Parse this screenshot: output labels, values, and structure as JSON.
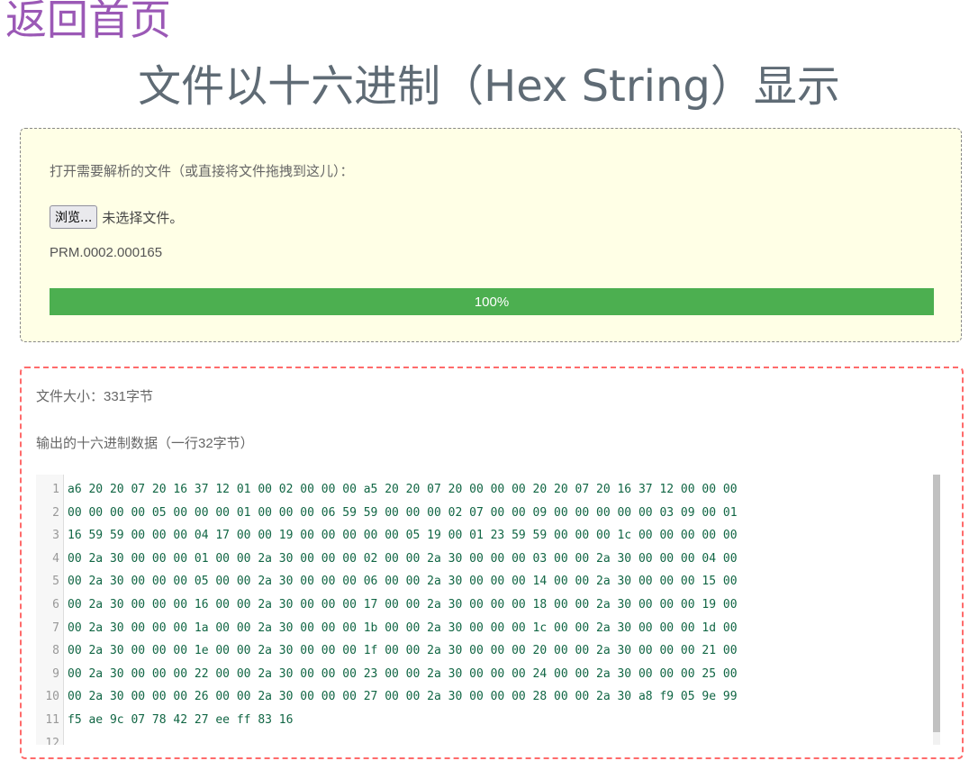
{
  "nav": {
    "back_label": "返回首页"
  },
  "header": {
    "title": "文件以十六进制（Hex String）显示"
  },
  "upload": {
    "prompt": "打开需要解析的文件（或直接将文件拖拽到这儿）：",
    "browse_label": "浏览...",
    "no_file_label": "未选择文件。",
    "file_name": "PRM.0002.000165",
    "progress": {
      "percent": 100,
      "label": "100%"
    },
    "progress_color": "#4caf50"
  },
  "output": {
    "file_size_label": "文件大小：331字节",
    "output_label": "输出的十六进制数据（一行32字节）",
    "lines": [
      {
        "num": "1",
        "text": "a6 20 20 07 20 16 37 12 01 00 02 00 00 00 a5 20 20 07 20 00 00 00 20 20 07 20 16 37 12 00 00 00"
      },
      {
        "num": "2",
        "text": "00 00 00 00 05 00 00 00 01 00 00 00 06 59 59 00 00 00 02 07 00 00 09 00 00 00 00 00 03 09 00 01"
      },
      {
        "num": "3",
        "text": "16 59 59 00 00 00 04 17 00 00 19 00 00 00 00 00 05 19 00 01 23 59 59 00 00 00 1c 00 00 00 00 00"
      },
      {
        "num": "4",
        "text": "00 2a 30 00 00 00 01 00 00 2a 30 00 00 00 02 00 00 2a 30 00 00 00 03 00 00 2a 30 00 00 00 04 00"
      },
      {
        "num": "5",
        "text": "00 2a 30 00 00 00 05 00 00 2a 30 00 00 00 06 00 00 2a 30 00 00 00 14 00 00 2a 30 00 00 00 15 00"
      },
      {
        "num": "6",
        "text": "00 2a 30 00 00 00 16 00 00 2a 30 00 00 00 17 00 00 2a 30 00 00 00 18 00 00 2a 30 00 00 00 19 00"
      },
      {
        "num": "7",
        "text": "00 2a 30 00 00 00 1a 00 00 2a 30 00 00 00 1b 00 00 2a 30 00 00 00 1c 00 00 2a 30 00 00 00 1d 00"
      },
      {
        "num": "8",
        "text": "00 2a 30 00 00 00 1e 00 00 2a 30 00 00 00 1f 00 00 2a 30 00 00 00 20 00 00 2a 30 00 00 00 21 00"
      },
      {
        "num": "9",
        "text": "00 2a 30 00 00 00 22 00 00 2a 30 00 00 00 23 00 00 2a 30 00 00 00 24 00 00 2a 30 00 00 00 25 00"
      },
      {
        "num": "10",
        "text": "00 2a 30 00 00 00 26 00 00 2a 30 00 00 00 27 00 00 2a 30 00 00 00 28 00 00 2a 30 a8 f9 05 9e 99"
      },
      {
        "num": "11",
        "text": "f5 ae 9c 07 78 42 27 ee ff 83 16"
      },
      {
        "num": "12",
        "text": ""
      }
    ]
  }
}
